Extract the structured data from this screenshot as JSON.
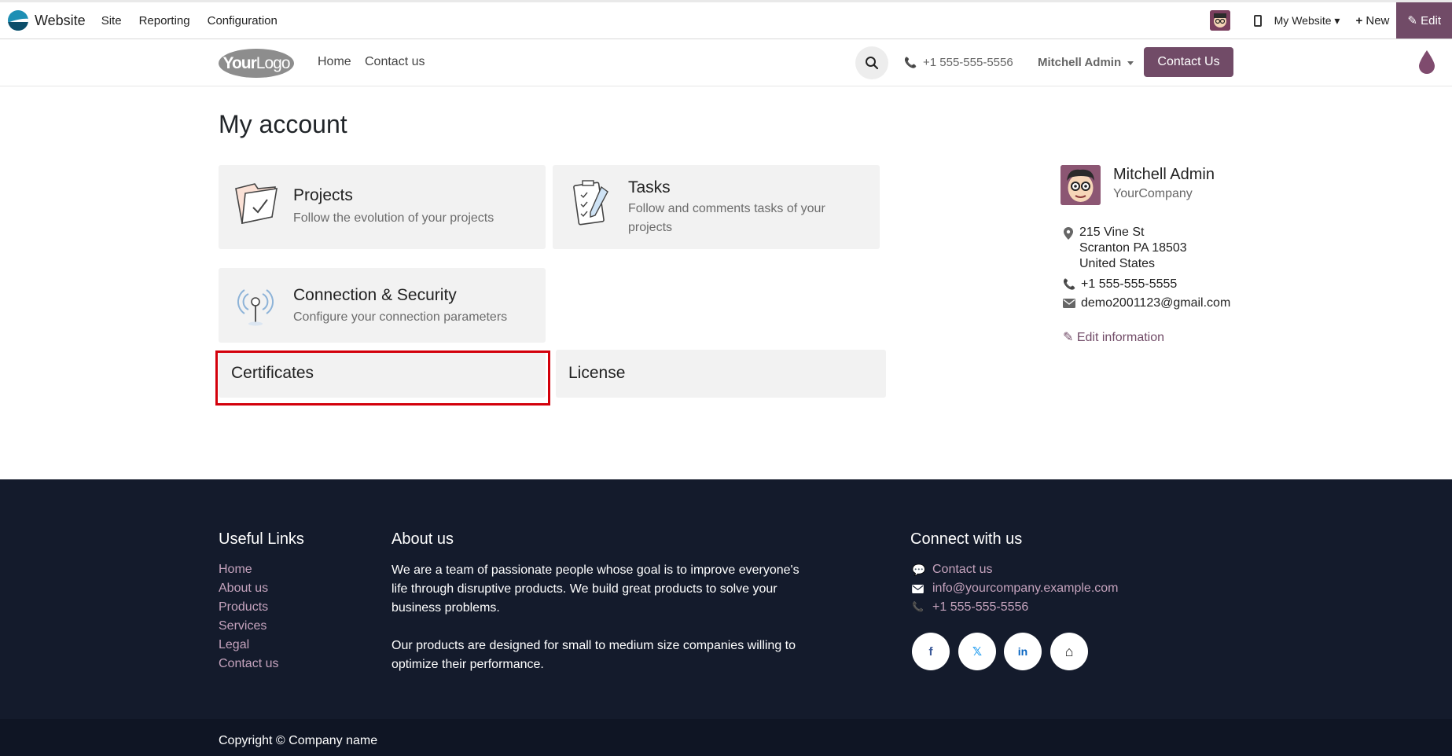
{
  "adminbar": {
    "app_name": "Website",
    "menus": [
      "Site",
      "Reporting",
      "Configuration"
    ],
    "website_selector": "My Website",
    "new_label": "New",
    "edit_label": "Edit"
  },
  "header": {
    "logo_text_bold": "Your",
    "logo_text_light": "Logo",
    "nav": [
      "Home",
      "Contact us"
    ],
    "phone": "+1 555-555-5556",
    "user": "Mitchell Admin",
    "contact_button": "Contact Us"
  },
  "main": {
    "title": "My account",
    "cards": {
      "projects": {
        "title": "Projects",
        "subtitle": "Follow the evolution of your projects"
      },
      "tasks": {
        "title": "Tasks",
        "subtitle_line1": "Follow and comments tasks of your",
        "subtitle_line2": "projects"
      },
      "connection": {
        "title": "Connection & Security",
        "subtitle": "Configure your connection parameters"
      },
      "certificates": {
        "title": "Certificates"
      },
      "license": {
        "title": "License"
      }
    }
  },
  "profile": {
    "name": "Mitchell Admin",
    "company": "YourCompany",
    "address": [
      "215 Vine St",
      "Scranton PA 18503",
      "United States"
    ],
    "phone": "+1 555-555-5555",
    "email": "demo2001123@gmail.com",
    "edit_label": "Edit information"
  },
  "footer": {
    "useful_links_title": "Useful Links",
    "links": [
      "Home",
      "About us",
      "Products",
      "Services",
      "Legal",
      "Contact us"
    ],
    "about_title": "About us",
    "about_p1": [
      "We are a team of passionate people whose goal is to improve everyone's",
      "life through disruptive products. We build great products to solve your",
      "business problems."
    ],
    "about_p2": [
      "Our products are designed for small to medium size companies willing to",
      "optimize their performance."
    ],
    "connect_title": "Connect with us",
    "connect_contact": "Contact us",
    "connect_email": "info@yourcompany.example.com",
    "connect_phone": "+1 555-555-5556",
    "social": [
      "f",
      "𝕏",
      "in",
      "⌂"
    ],
    "copyright": "Copyright © Company name"
  },
  "colors": {
    "brand": "#714b67",
    "highlight": "#d3000b",
    "footer_bg": "#141b2c"
  }
}
